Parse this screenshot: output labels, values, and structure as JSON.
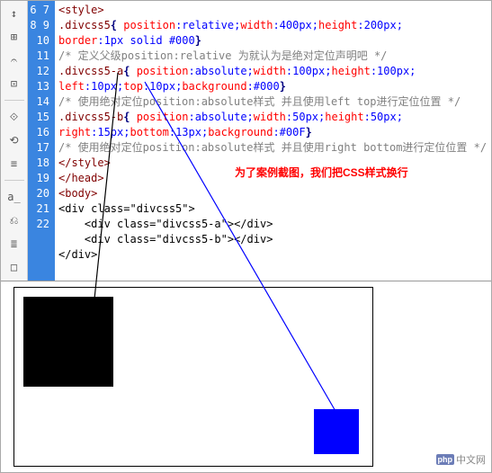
{
  "lineStart": 6,
  "lineEnd": 22,
  "code": {
    "l6": {
      "tag": "<style>"
    },
    "l7": {
      "selector": ".divcss5",
      "open": "{",
      "p1": " position",
      "v1": ":relative;",
      "p2": "width",
      "v2": ":400px;",
      "p3": "height",
      "v3": ":200px;"
    },
    "l8": {
      "p1": "border",
      "v1": ":1px solid #000",
      "close": "}"
    },
    "l9": {
      "comment": "/* 定义父级position:relative 为就认为是绝对定位声明吧 */"
    },
    "l10": {
      "selector": ".divcss5-a",
      "open": "{",
      "p1": " position",
      "v1": ":absolute;",
      "p2": "width",
      "v2": ":100px;",
      "p3": "height",
      "v3": ":100px;"
    },
    "l11": {
      "p1": "left",
      "v1": ":10px;",
      "p2": "top",
      "v2": ":10px;",
      "p3": "background",
      "v3": ":#000",
      "close": "}"
    },
    "l12": {
      "comment": "/* 使用绝对定位position:absolute样式 并且使用left top进行定位位置 */"
    },
    "l13": {
      "selector": ".divcss5-b",
      "open": "{",
      "p1": " position",
      "v1": ":absolute;",
      "p2": "width",
      "v2": ":50px;",
      "p3": "height",
      "v3": ":50px;"
    },
    "l14": {
      "p1": "right",
      "v1": ":15px;",
      "p2": "bottom",
      "v2": ":13px;",
      "p3": "background",
      "v3": ":#00F",
      "close": "}"
    },
    "l15": {
      "comment": "/* 使用绝对定位position:absolute样式 并且使用right bottom进行定位位置 */"
    },
    "l16": {
      "tag": "</style>"
    },
    "l17": {
      "tag": "</head>"
    },
    "l18": {
      "tag": "<body>"
    },
    "l19": {
      "html": "<div class=\"divcss5\">"
    },
    "l20": {
      "html": "    <div class=\"divcss5-a\"></div>"
    },
    "l21": {
      "html": "    <div class=\"divcss5-b\"></div>"
    },
    "l22": {
      "html": "</div>"
    }
  },
  "annotation": "为了案例截图，我们把CSS样式换行",
  "tools": [
    "↕",
    "⊞",
    "𝄐",
    "⊡",
    "⟐",
    "⟲",
    "≡"
  ],
  "tools2": [
    "a̲",
    "⎌",
    "≣",
    "□"
  ],
  "watermark": {
    "badge": "php",
    "text": "中文网"
  }
}
